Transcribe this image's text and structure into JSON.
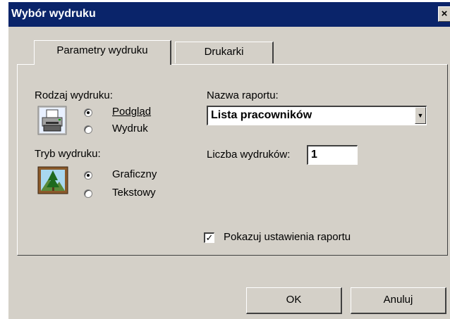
{
  "window": {
    "title": "Wybór wydruku",
    "close_label": "×"
  },
  "tabs": [
    {
      "label": "Parametry wydruku",
      "active": true
    },
    {
      "label": "Drukarki",
      "active": false
    }
  ],
  "print_type": {
    "heading": "Rodzaj wydruku:",
    "options": [
      {
        "label": "Podgląd",
        "checked": true
      },
      {
        "label": "Wydruk",
        "checked": false
      }
    ],
    "icon": "printer-icon"
  },
  "print_mode": {
    "heading": "Tryb wydruku:",
    "options": [
      {
        "label": "Graficzny",
        "checked": true
      },
      {
        "label": "Tekstowy",
        "checked": false
      }
    ],
    "icon": "picture-icon"
  },
  "report": {
    "name_label": "Nazwa raportu:",
    "name_value": "Lista pracowników",
    "copies_label": "Liczba wydruków:",
    "copies_value": "1",
    "show_settings_label": "Pokazuj ustawienia raportu",
    "show_settings_checked": true
  },
  "buttons": {
    "ok_label": "OK",
    "cancel_label": "Anuluj"
  },
  "colors": {
    "titlebar": "#0a246a",
    "face": "#d4d0c8"
  }
}
